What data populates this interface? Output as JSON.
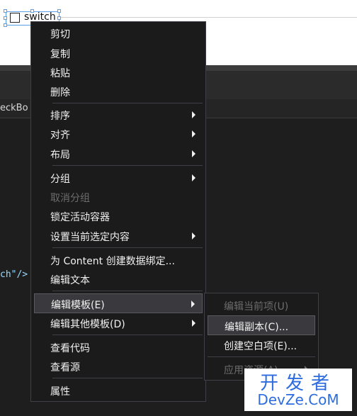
{
  "designer": {
    "control_text": "switch"
  },
  "editor": {
    "tab_fragment": "eckBo",
    "code_fragment": "ch\"/>"
  },
  "context_menu": {
    "items": [
      {
        "label": "剪切",
        "enabled": true
      },
      {
        "label": "复制",
        "enabled": true
      },
      {
        "label": "粘贴",
        "enabled": true
      },
      {
        "label": "删除",
        "enabled": true
      },
      {
        "label": "排序",
        "enabled": true,
        "submenu": true
      },
      {
        "label": "对齐",
        "enabled": true,
        "submenu": true
      },
      {
        "label": "布局",
        "enabled": true,
        "submenu": true
      },
      {
        "label": "分组",
        "enabled": true,
        "submenu": true
      },
      {
        "label": "取消分组",
        "enabled": false
      },
      {
        "label": "锁定活动容器",
        "enabled": true
      },
      {
        "label": "设置当前选定内容",
        "enabled": true,
        "submenu": true
      },
      {
        "label": "为 Content 创建数据绑定...",
        "enabled": true
      },
      {
        "label": "编辑文本",
        "enabled": true
      },
      {
        "label": "编辑模板(E)",
        "enabled": true,
        "submenu": true,
        "highlighted": true
      },
      {
        "label": "编辑其他模板(D)",
        "enabled": true,
        "submenu": true
      },
      {
        "label": "查看代码",
        "enabled": true
      },
      {
        "label": "查看源",
        "enabled": true
      },
      {
        "label": "属性",
        "enabled": true
      }
    ]
  },
  "submenu": {
    "items": [
      {
        "label": "编辑当前项(U)",
        "enabled": false
      },
      {
        "label": "编辑副本(C)...",
        "enabled": true,
        "highlighted": true
      },
      {
        "label": "创建空白项(E)...",
        "enabled": true
      },
      {
        "label": "应用资源(A)",
        "enabled": false,
        "submenu": true
      }
    ]
  },
  "watermark": {
    "line1": "开发者",
    "line2": "DevZe.CoM"
  },
  "colors": {
    "menu_bg": "#1b1b1c",
    "selection_border": "#5aa0e6",
    "watermark": "#2d6cdf"
  }
}
